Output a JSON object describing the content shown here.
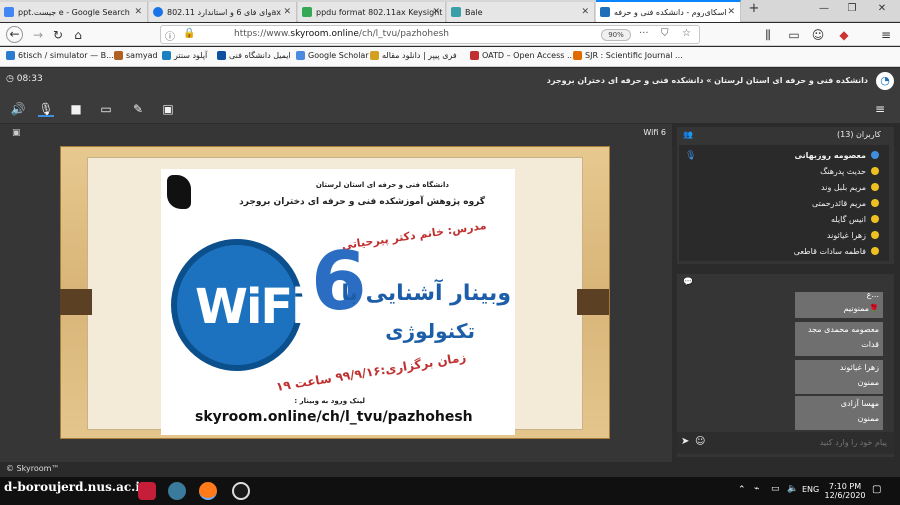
{
  "tabs": [
    {
      "label": "ppt.جیست e - Google Search",
      "color": "#4285f4"
    },
    {
      "label": "وای فای 6 و استاندارد 802.11ax",
      "color": "#1a73e8"
    },
    {
      "label": "ppdu format 802.11ax Keysight",
      "color": "#34a853"
    },
    {
      "label": "Bale",
      "color": "#3aa0a8"
    },
    {
      "label": "اسکای‌روم - دانشکده فنی و حرفه",
      "color": "#1e6fb8"
    }
  ],
  "window": {
    "min": "—",
    "max": "❐",
    "close": "✕",
    "new_tab": "+"
  },
  "nav": {
    "url_prefix": "https://www.",
    "url_host": "skyroom.online",
    "url_path": "/ch/l_tvu/pazhohesh",
    "zoom": "90%"
  },
  "bookmarks": [
    "6tisch / simulator — B...",
    "samyad",
    "آپلود سنتر",
    "ایمیل دانشگاه فنی",
    "Google Scholar",
    "فری پیپر | دانلود مقاله",
    "OATD – Open Access ...",
    "SJR : Scientific Journal ..."
  ],
  "header": {
    "timer": "08:33",
    "title": "دانشکده فنی و حرفه ای استان لرستان » دانشکده فنی و حرفه ای دختران بروجرد"
  },
  "stage": {
    "label": "Wifi 6"
  },
  "slide": {
    "line1": "دانشگاه فنی و حرفه ای استان لرستان",
    "line2": "گروه پژوهش آموزشکده فنی و حرفه ای دختران بروجرد",
    "teacher": "مدرس: خانم دکتر پیرحیاتی",
    "wifi": "WiFi",
    "six": "6",
    "title1": "وبینار آشنایی با",
    "title2": "تکنولوژی",
    "date": "زمان برگزاری:۹۹/۹/۱۶ ساعت ۱۹",
    "link_label": "لینک ورود به وبینار :",
    "link": "skyroom.online/ch/l_tvu/pazhohesh"
  },
  "users": {
    "title": "کاربران (13)",
    "items": [
      "معصومه روزبهانی",
      "حدیث پدرهنگ",
      "مریم بلبل وند",
      "مریم قائدرحمتی",
      "انیس گایله",
      "زهرا غیاثوند",
      "فاطمه سادات قاطعی"
    ]
  },
  "chat": {
    "messages": [
      {
        "name": "ع...",
        "text": "ممنونیم🌹"
      },
      {
        "name": "معصومه محمدی مجد",
        "text": "قدات"
      },
      {
        "name": "زهرا غیاثوند",
        "text": "ممنون"
      },
      {
        "name": "مهسا آزادی",
        "text": "ممنون"
      }
    ],
    "placeholder": "پیام خود را وارد کنید"
  },
  "footer": "© Skyroom™",
  "taskbar": {
    "brand": "d-boroujerd.nus.ac.ir",
    "lang": "ENG",
    "time": "7:10 PM",
    "date": "12/6/2020"
  }
}
